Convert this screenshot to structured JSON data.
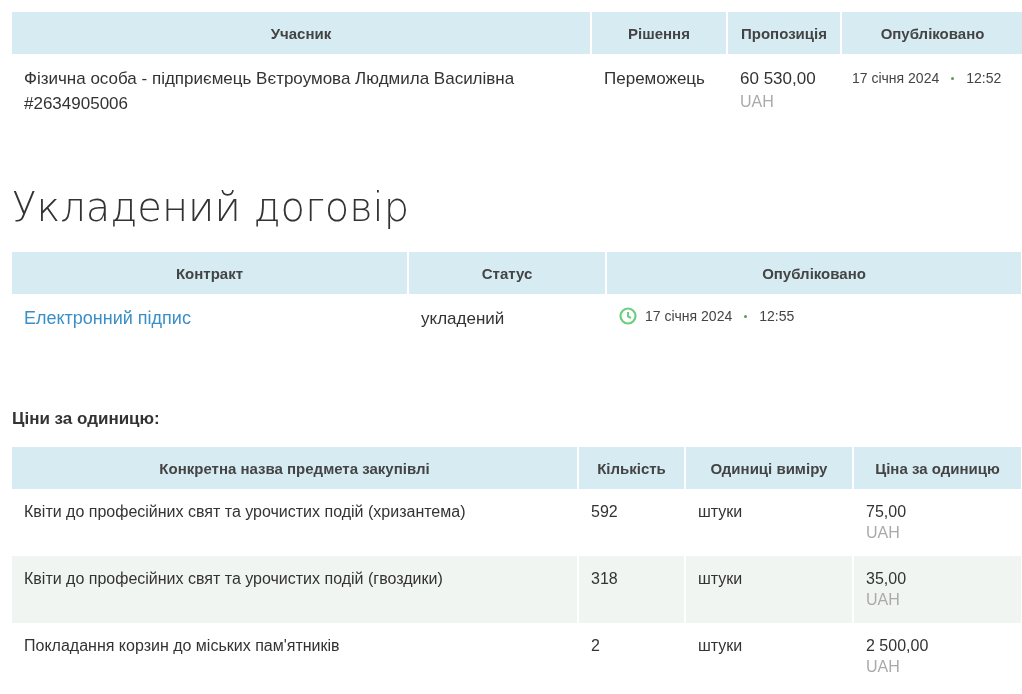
{
  "bids": {
    "columns": [
      "Учасник",
      "Рішення",
      "Пропозиція",
      "Опубліковано"
    ],
    "rows": [
      {
        "participant": "Фізична особа - підприємець Вєтроумова Людмила Василівна",
        "code": "#2634905006",
        "decision": "Переможець",
        "amount": "60 530,00",
        "currency": "UAH",
        "date": "17 січня 2024",
        "time": "12:52"
      }
    ]
  },
  "contract_heading": "Укладений договір",
  "contracts": {
    "columns": [
      "Контракт",
      "Статус",
      "Опубліковано"
    ],
    "rows": [
      {
        "name": "Електронний підпис",
        "status": "укладений",
        "date": "17 січня 2024",
        "time": "12:55"
      }
    ]
  },
  "unit_prices_title": "Ціни за одиницю:",
  "items": {
    "columns": [
      "Конкретна назва предмета закупівлі",
      "Кількість",
      "Одиниці виміру",
      "Ціна за одиницю"
    ],
    "rows": [
      {
        "name": "Квіти до професійних свят та урочистих подій (хризантема)",
        "quantity": "592",
        "unit": "штуки",
        "price": "75,00",
        "currency": "UAH",
        "selected": false
      },
      {
        "name": "Квіти до професійних свят та урочистих подій (гвоздики)",
        "quantity": "318",
        "unit": "штуки",
        "price": "35,00",
        "currency": "UAH",
        "selected": true
      },
      {
        "name": "Покладання корзин до міських пам'ятників",
        "quantity": "2",
        "unit": "штуки",
        "price": "2 500,00",
        "currency": "UAH",
        "selected": false
      }
    ]
  }
}
